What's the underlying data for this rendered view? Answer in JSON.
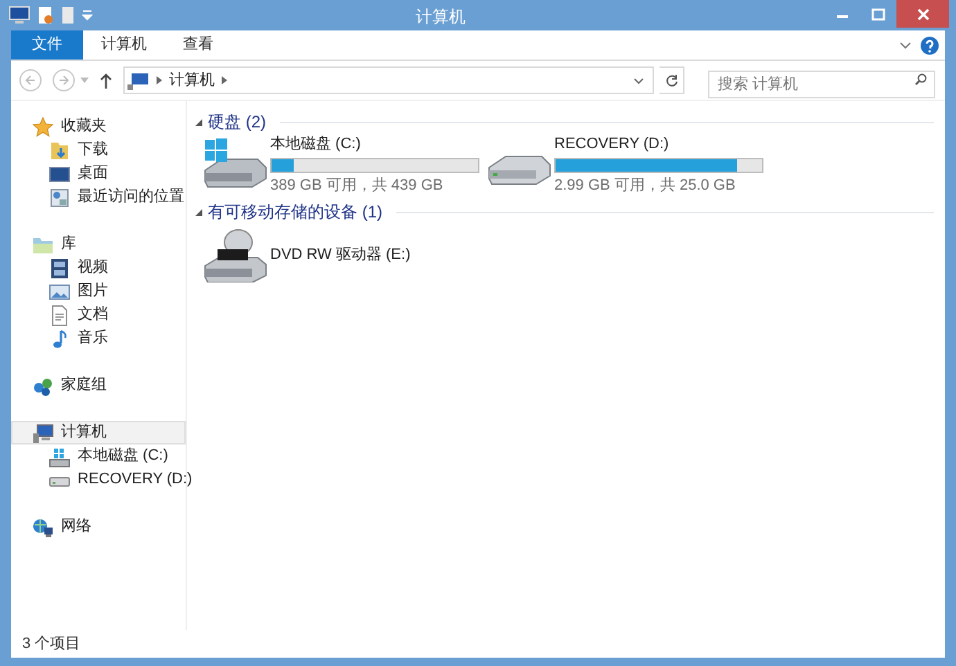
{
  "window": {
    "title": "计算机"
  },
  "ribbon_tabs": [
    {
      "label": "文件",
      "selected": true
    },
    {
      "label": "计算机",
      "selected": false
    },
    {
      "label": "查看",
      "selected": false
    }
  ],
  "address": {
    "path": [
      "计算机"
    ]
  },
  "search": {
    "placeholder": "搜索 计算机"
  },
  "sidebar": [
    {
      "kind": "favorites",
      "label": "收藏夹",
      "selected": false,
      "children": [
        {
          "kind": "downloads",
          "label": "下载",
          "selected": false
        },
        {
          "kind": "desktop",
          "label": "桌面",
          "selected": false
        },
        {
          "kind": "recent",
          "label": "最近访问的位置",
          "selected": false
        }
      ]
    },
    {
      "kind": "library",
      "label": "库",
      "selected": false,
      "children": [
        {
          "kind": "video",
          "label": "视频",
          "selected": false
        },
        {
          "kind": "pictures",
          "label": "图片",
          "selected": false
        },
        {
          "kind": "documents",
          "label": "文档",
          "selected": false
        },
        {
          "kind": "music",
          "label": "音乐",
          "selected": false
        }
      ]
    },
    {
      "kind": "homegroup",
      "label": "家庭组",
      "selected": false
    },
    {
      "kind": "computer",
      "label": "计算机",
      "selected": true,
      "children": [
        {
          "kind": "system-drive",
          "label": "本地磁盘 (C:)",
          "selected": false
        },
        {
          "kind": "drive",
          "label": "RECOVERY (D:)",
          "selected": false
        }
      ]
    },
    {
      "kind": "network",
      "label": "网络",
      "selected": false
    }
  ],
  "sections": [
    {
      "title": "硬盘 (2)",
      "expanded": true,
      "items": [
        {
          "kind": "system-drive",
          "name": "本地磁盘 (C:)",
          "level": 0.11,
          "space": "389 GB 可用，共 439 GB"
        },
        {
          "kind": "drive",
          "name": "RECOVERY (D:)",
          "level": 0.88,
          "space": "2.99 GB 可用，共 25.0 GB"
        }
      ]
    },
    {
      "title": "有可移动存储的设备 (1)",
      "expanded": true,
      "items": [
        {
          "kind": "dvd",
          "name": "DVD RW 驱动器 (E:)"
        }
      ]
    }
  ],
  "status_bar": {
    "text": "3 个项目"
  }
}
